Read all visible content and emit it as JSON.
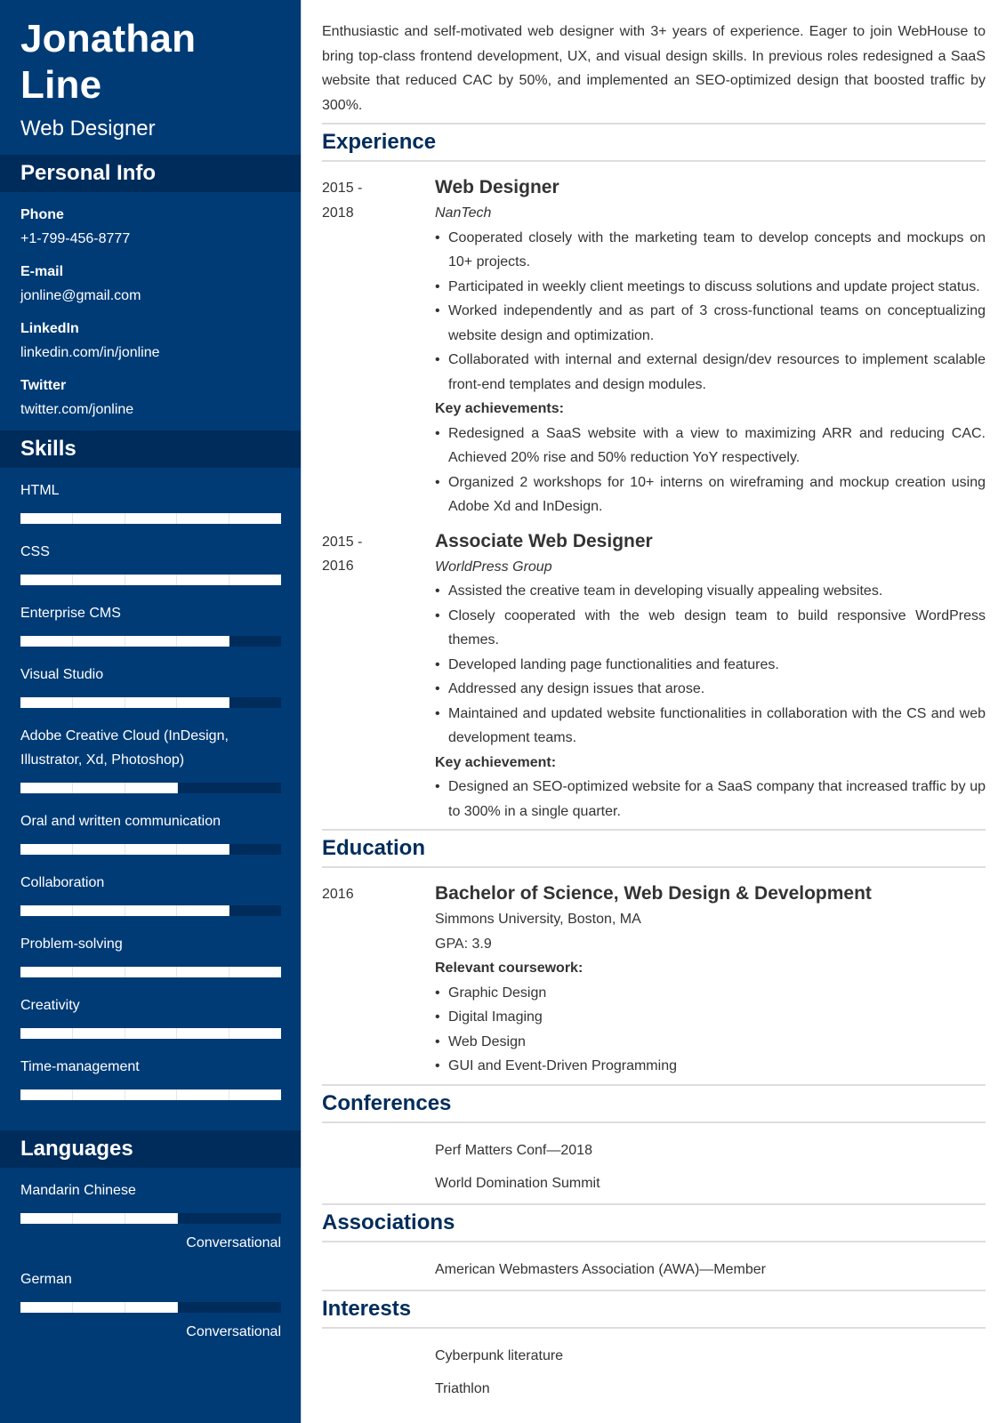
{
  "profile": {
    "first_name": "Jonathan",
    "last_name": "Line",
    "title": "Web Designer"
  },
  "sidebar": {
    "personal_info_header": "Personal Info",
    "personal_info": [
      {
        "label": "Phone",
        "value": "+1-799-456-8777"
      },
      {
        "label": "E-mail",
        "value": "jonline@gmail.com"
      },
      {
        "label": "LinkedIn",
        "value": "linkedin.com/in/jonline"
      },
      {
        "label": "Twitter",
        "value": "twitter.com/jonline"
      }
    ],
    "skills_header": "Skills",
    "skills_scale_max": 5,
    "skills": [
      {
        "name": "HTML",
        "level": 5
      },
      {
        "name": "CSS",
        "level": 5
      },
      {
        "name": "Enterprise CMS",
        "level": 4
      },
      {
        "name": "Visual Studio",
        "level": 4
      },
      {
        "name": "Adobe Creative Cloud (InDesign, Illustrator, Xd, Photoshop)",
        "level": 3
      },
      {
        "name": "Oral and written communication",
        "level": 4
      },
      {
        "name": "Collaboration",
        "level": 4
      },
      {
        "name": "Problem-solving",
        "level": 5
      },
      {
        "name": "Creativity",
        "level": 5
      },
      {
        "name": "Time-management",
        "level": 5
      }
    ],
    "languages_header": "Languages",
    "languages": [
      {
        "name": "Mandarin Chinese",
        "level": 3,
        "level_label": "Conversational"
      },
      {
        "name": "German",
        "level": 3,
        "level_label": "Conversational"
      }
    ]
  },
  "main": {
    "summary": "Enthusiastic and self-motivated web designer with 3+ years of experience. Eager to join WebHouse to bring top-class frontend development, UX, and visual design skills. In previous roles redesigned a SaaS website that reduced CAC by 50%, and implemented an SEO-optimized design that boosted traffic by 300%.",
    "experience": {
      "title": "Experience",
      "entries": [
        {
          "date_start": "2015 -",
          "date_end": "2018",
          "role": "Web Designer",
          "company": "NanTech",
          "bullets": [
            "Cooperated closely with the marketing team to develop concepts and mockups on 10+ projects.",
            "Participated in weekly client meetings to discuss solutions and update project status.",
            "Worked independently and as part of 3 cross-functional teams on conceptualizing website design and optimization.",
            "Collaborated with internal and external design/dev resources to implement scalable front-end templates and design modules."
          ],
          "achievements_label": "Key achievements:",
          "achievements": [
            "Redesigned a SaaS website with a view to maximizing ARR and reducing CAC. Achieved 20% rise and 50% reduction YoY respectively.",
            "Organized 2 workshops for 10+ interns on wireframing and mockup creation using Adobe Xd and InDesign."
          ]
        },
        {
          "date_start": "2015 -",
          "date_end": "2016",
          "role": "Associate Web Designer",
          "company": "WorldPress Group",
          "bullets": [
            "Assisted the creative team in developing visually appealing websites.",
            "Closely cooperated with the web design team to build responsive WordPress themes.",
            "Developed landing page functionalities and features.",
            "Addressed any design issues that arose.",
            "Maintained and updated website functionalities in collaboration with the CS and web development teams."
          ],
          "achievements_label": "Key achievement:",
          "achievements": [
            "Designed an SEO-optimized website for a SaaS company that increased traffic by up to 300% in a single quarter."
          ]
        }
      ]
    },
    "education": {
      "title": "Education",
      "date": "2016",
      "degree": "Bachelor of Science, Web Design & Development",
      "school": "Simmons University, Boston, MA",
      "gpa": "GPA: 3.9",
      "coursework_label": "Relevant coursework:",
      "coursework": [
        "Graphic Design",
        "Digital Imaging",
        "Web Design",
        "GUI and Event-Driven Programming"
      ]
    },
    "conferences": {
      "title": "Conferences",
      "items": [
        "Perf Matters Conf—2018",
        "World Domination Summit"
      ]
    },
    "associations": {
      "title": "Associations",
      "items": [
        "American Webmasters Association (AWA)—Member"
      ]
    },
    "interests": {
      "title": "Interests",
      "items": [
        "Cyberpunk literature",
        "Triathlon"
      ]
    }
  },
  "colors": {
    "sidebar_bg": "#003b76",
    "sidebar_header_bg": "#002c5b",
    "accent": "#002c5b",
    "text": "#333333",
    "divider": "#dddddd"
  }
}
